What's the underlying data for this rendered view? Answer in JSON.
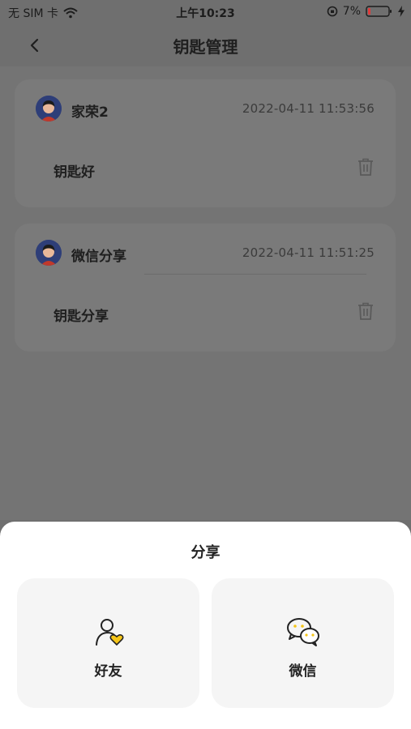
{
  "status_bar": {
    "carrier": "无 SIM 卡",
    "time": "上午10:23",
    "battery": "7%"
  },
  "nav": {
    "title": "钥匙管理",
    "back_icon": "chevron-left-icon"
  },
  "keys": [
    {
      "user": "家荣2",
      "datetime": "2022-04-11 11:53:56",
      "key_name": "钥匙好"
    },
    {
      "user": "微信分享",
      "datetime": "2022-04-11 11:51:25",
      "key_name": "钥匙分享"
    }
  ],
  "share_sheet": {
    "title": "分享",
    "options": [
      {
        "label": "好友",
        "icon": "friend-heart-icon"
      },
      {
        "label": "微信",
        "icon": "wechat-icon"
      }
    ]
  },
  "colors": {
    "accent": "#F5C518",
    "overlay": "#6f6f6f",
    "sheet_bg": "#ffffff",
    "option_bg": "#f5f5f5"
  }
}
